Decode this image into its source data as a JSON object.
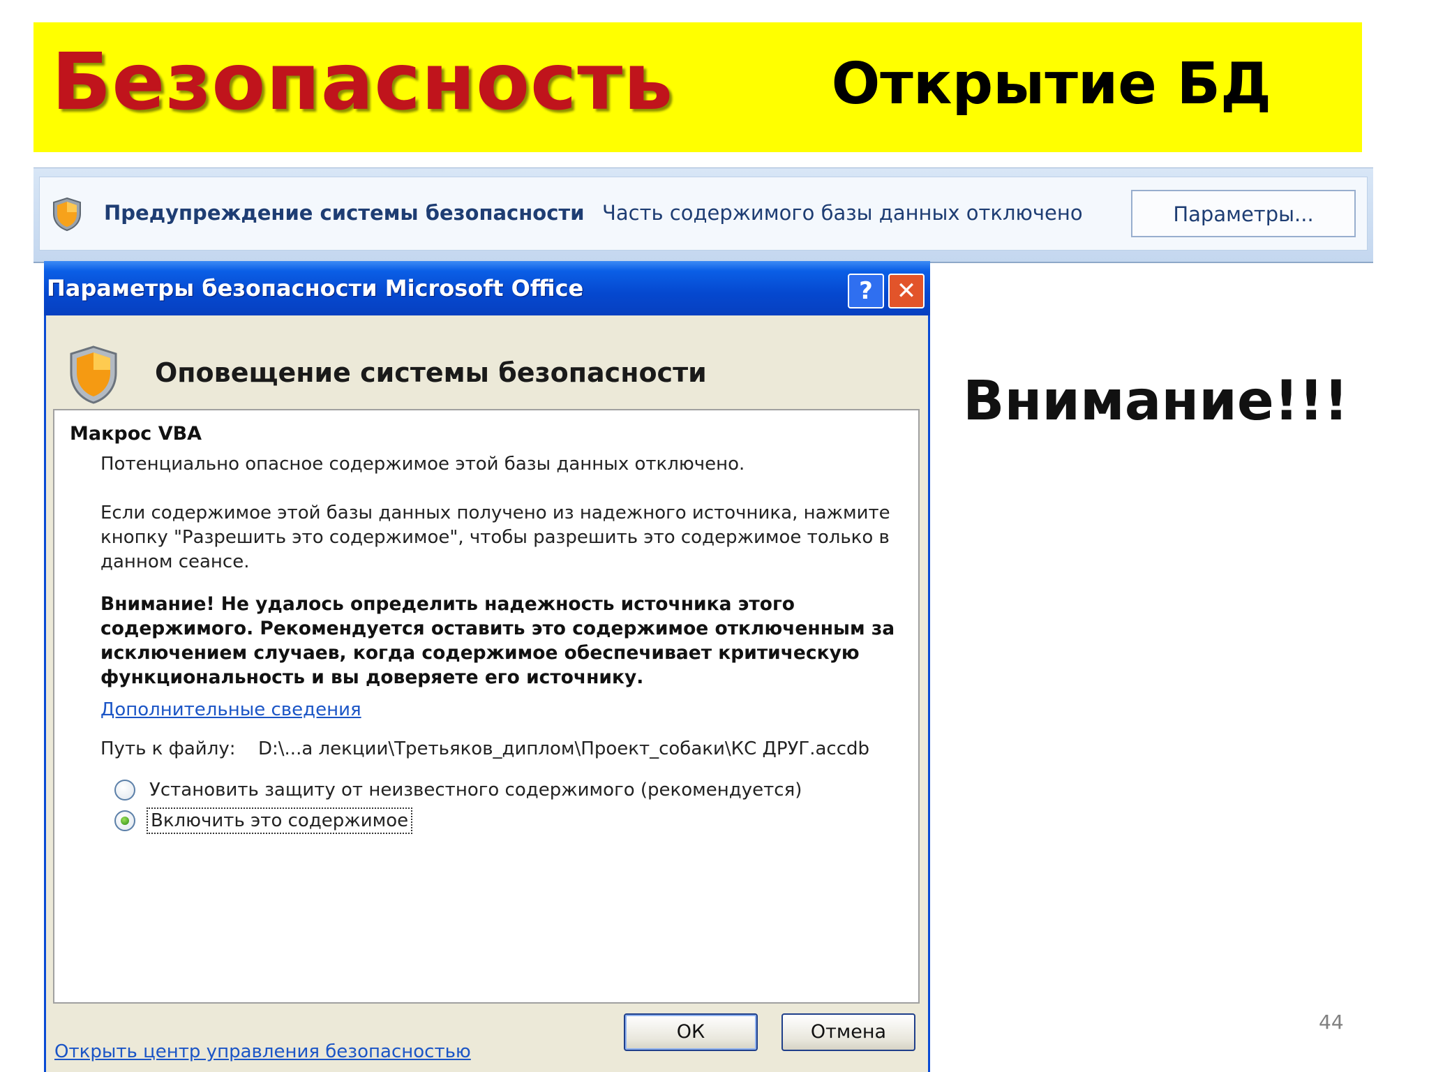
{
  "slide": {
    "title": "Безопасность",
    "subtitle": "Открытие БД",
    "callout": "Внимание!!!",
    "page_number": "44"
  },
  "message_bar": {
    "icon": "shield-icon",
    "title": "Предупреждение системы безопасности",
    "text": "Часть содержимого базы данных отключено",
    "button_label": "Параметры..."
  },
  "dialog": {
    "title": "Параметры безопасности Microsoft Office",
    "help_label": "?",
    "close_label": "✕",
    "heading": "Оповещение системы безопасности",
    "section_title": "Макрос VBA",
    "line1": "Потенциально опасное содержимое этой базы данных отключено.",
    "paragraph": "Если содержимое этой базы данных получено из надежного источника, нажмите кнопку \"Разрешить это содержимое\", чтобы разрешить это содержимое только в данном сеансе.",
    "warning": "Внимание! Не удалось определить надежность источника этого содержимого. Рекомендуется оставить это содержимое отключенным за исключением случаев, когда содержимое обеспечивает критическую функциональность и вы доверяете его источнику.",
    "more_info_link": "Дополнительные сведения",
    "path_label": "Путь к файлу:",
    "path_value": "D:\\...а лекции\\Третьяков_диплом\\Проект_собаки\\КС  ДРУГ.accdb",
    "options": [
      {
        "label": "Установить защиту от неизвестного содержимого (рекомендуется)",
        "checked": false
      },
      {
        "label": "Включить это содержимое",
        "checked": true
      }
    ],
    "trust_center_link": "Открыть центр управления безопасностью",
    "ok_label": "ОК",
    "cancel_label": "Отмена"
  }
}
